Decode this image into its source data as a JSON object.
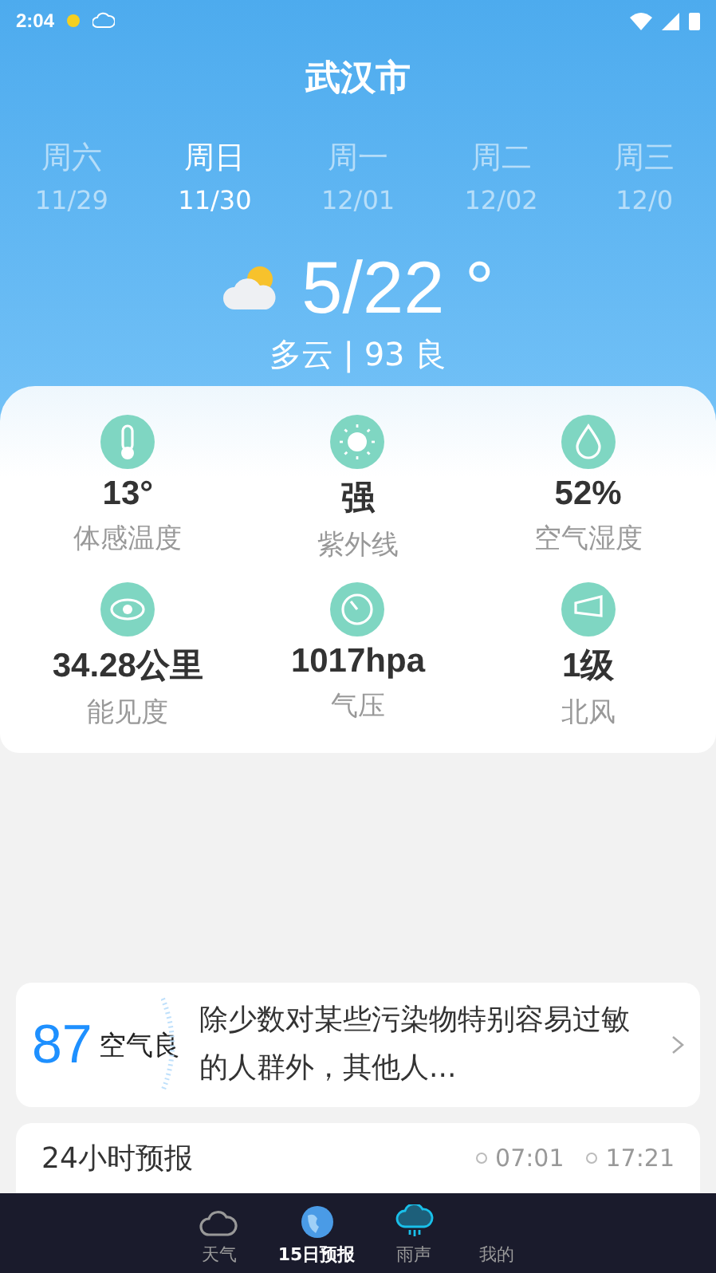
{
  "status_bar": {
    "time": "2:04"
  },
  "city": "武汉市",
  "days": [
    {
      "weekday": "周六",
      "date": "11/29",
      "selected": false
    },
    {
      "weekday": "周日",
      "date": "11/30",
      "selected": true
    },
    {
      "weekday": "周一",
      "date": "12/01",
      "selected": false
    },
    {
      "weekday": "周二",
      "date": "12/02",
      "selected": false
    },
    {
      "weekday": "周三",
      "date": "12/0",
      "selected": false
    }
  ],
  "current": {
    "temperature": "5/22 °",
    "summary": "多云 | 93 良"
  },
  "details": [
    {
      "kind": "thermometer",
      "value": "13°",
      "label": "体感温度"
    },
    {
      "kind": "sun",
      "value": "强",
      "label": "紫外线"
    },
    {
      "kind": "drop",
      "value": "52%",
      "label": "空气湿度"
    },
    {
      "kind": "eye",
      "value": "34.28公里",
      "label": "能见度"
    },
    {
      "kind": "gauge",
      "value": "1017hpa",
      "label": "气压"
    },
    {
      "kind": "windsock",
      "value": "1级",
      "label": "北风"
    }
  ],
  "air_quality": {
    "index": "87",
    "level": "空气良",
    "description": "除少数对某些污染物特别容易过敏的人群外，其他人..."
  },
  "forecast_24h": {
    "title": "24小时预报",
    "sunrise": "07:01",
    "sunset": "17:21"
  },
  "nav": [
    {
      "kind": "cloud",
      "label": "天气",
      "selected": false
    },
    {
      "kind": "globe",
      "label": "15日预报",
      "selected": true
    },
    {
      "kind": "rain",
      "label": "雨声",
      "selected": false
    },
    {
      "kind": "none",
      "label": "我的",
      "selected": false
    }
  ]
}
